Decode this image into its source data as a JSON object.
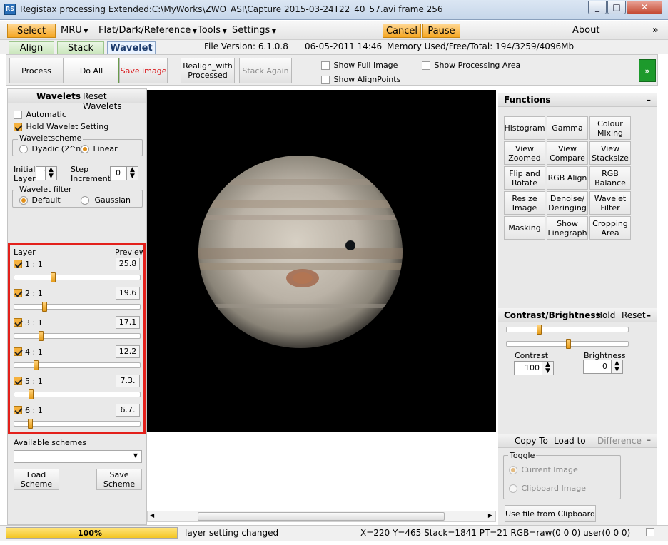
{
  "window": {
    "title": "Registax processing Extended:C:\\MyWorks\\ZWO_ASI\\Capture 2015-03-24T22_40_57.avi frame 256",
    "app_icon": "RS",
    "minimize": "_",
    "maximize": "□",
    "close": "✕"
  },
  "menu": {
    "select": "Select",
    "mru": "MRU",
    "flat": "Flat/Dark/Reference",
    "tools": "Tools",
    "settings": "Settings",
    "cancel": "Cancel",
    "pause": "Pause",
    "about": "About",
    "overflow": "»"
  },
  "tabs": [
    "Align",
    "Stack",
    "Wavelet"
  ],
  "info": {
    "version": "File Version: 6.1.0.8",
    "date": "06-05-2011 14:46",
    "memory": "Memory Used/Free/Total: 194/3259/4096Mb"
  },
  "toolbar": {
    "process": "Process",
    "do_all": "Do All",
    "save_image": "Save image",
    "realign": "Realign_with Processed",
    "stack_again": "Stack Again",
    "show_full": "Show Full Image",
    "show_alignpoints": "Show AlignPoints",
    "show_processing": "Show Processing Area",
    "expand": "»"
  },
  "wavelets": {
    "title": "Wavelets",
    "reset": "Reset Wavelets",
    "automatic": "Automatic",
    "hold": "Hold Wavelet Setting",
    "scheme_title": "Waveletscheme",
    "dyadic": "Dyadic (2^n)",
    "linear": "Linear",
    "initial_layer_label": "Initial Layer",
    "initial_layer": "1",
    "step_label": "Step Increment",
    "step": "0",
    "filter_title": "Wavelet filter",
    "default": "Default",
    "gaussian": "Gaussian",
    "layer_header": "Layer",
    "preview_header": "Preview",
    "layers": [
      {
        "label": "1 : 1",
        "value": "25.8",
        "slider": 0.3
      },
      {
        "label": "2 : 1",
        "value": "19.6",
        "slider": 0.23
      },
      {
        "label": "3 : 1",
        "value": "17.1",
        "slider": 0.2
      },
      {
        "label": "4 : 1",
        "value": "12.2",
        "slider": 0.16
      },
      {
        "label": "5 : 1",
        "value": "7.3.",
        "slider": 0.12
      },
      {
        "label": "6 : 1",
        "value": "6.7.",
        "slider": 0.11
      }
    ],
    "available_schemes": "Available schemes",
    "load_scheme": "Load Scheme",
    "save_scheme": "Save Scheme"
  },
  "functions": {
    "title": "Functions",
    "buttons": [
      "Histogram",
      "Gamma",
      "Colour Mixing",
      "View Zoomed",
      "View Compare",
      "View Stacksize",
      "Flip and Rotate",
      "RGB Align",
      "RGB Balance",
      "Resize Image",
      "Denoise/ Deringing",
      "Wavelet Filter",
      "Masking",
      "Show Linegraph",
      "Cropping Area"
    ]
  },
  "contrast": {
    "title": "Contrast/Brightness",
    "hold": "Hold",
    "reset": "Reset",
    "contrast_label": "Contrast",
    "contrast": "100",
    "brightness_label": "Brightness",
    "brightness": "0",
    "contrast_slider": 0.25,
    "brightness_slider": 0.5
  },
  "copyto": {
    "copy_to": "Copy To",
    "load_to": "Load to",
    "difference": "Difference",
    "toggle": "Toggle",
    "current": "Current Image",
    "clipboard": "Clipboard Image",
    "use_clipboard": "Use file from Clipboard"
  },
  "status": {
    "progress": "100%",
    "message": "layer setting changed",
    "coords": "X=220 Y=465 Stack=1841 PT=21 RGB=raw(0 0 0) user(0 0 0)"
  },
  "colors": {
    "accent_orange": "#f5a623",
    "highlight_red": "#e3201b",
    "save_red": "#d9191c"
  }
}
